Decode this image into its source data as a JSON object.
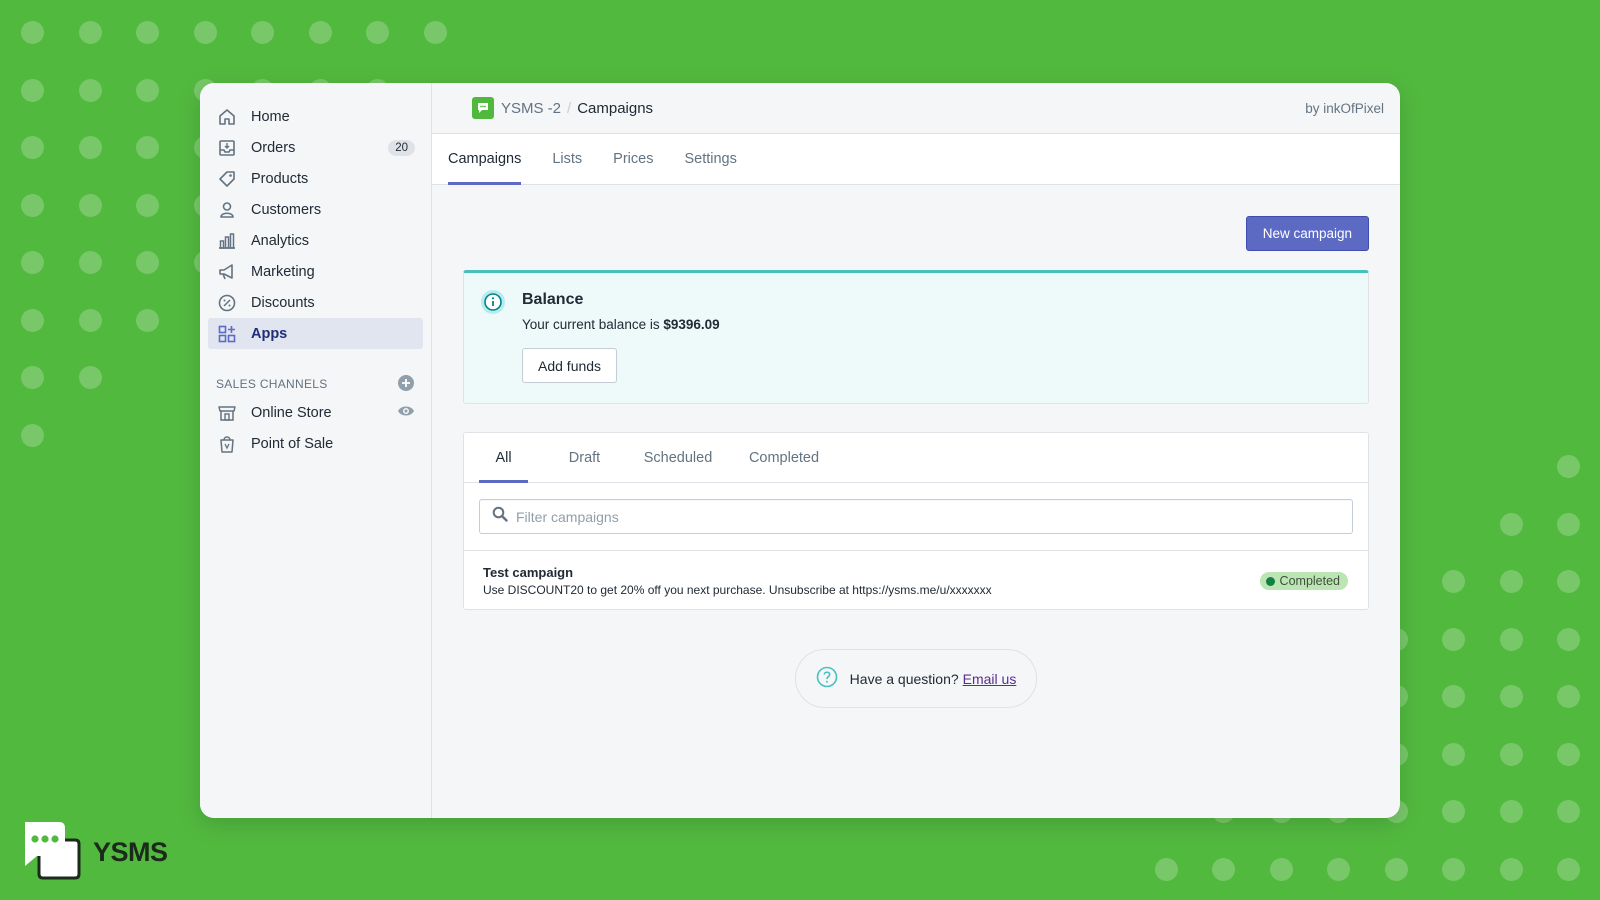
{
  "colors": {
    "background": "#52b93f",
    "primary": "#5c6ac4",
    "banner_accent": "#47c1bf",
    "status_success": "#108043",
    "link": "#5c2d91"
  },
  "sidebar": {
    "items": [
      {
        "label": "Home",
        "icon": "home-icon"
      },
      {
        "label": "Orders",
        "icon": "orders-icon",
        "badge": "20"
      },
      {
        "label": "Products",
        "icon": "tag-icon"
      },
      {
        "label": "Customers",
        "icon": "person-icon"
      },
      {
        "label": "Analytics",
        "icon": "bar-chart-icon"
      },
      {
        "label": "Marketing",
        "icon": "megaphone-icon"
      },
      {
        "label": "Discounts",
        "icon": "discount-icon"
      },
      {
        "label": "Apps",
        "icon": "apps-icon",
        "active": true
      }
    ],
    "sales_channels_heading": "SALES CHANNELS",
    "channels": [
      {
        "label": "Online Store",
        "icon": "store-icon"
      },
      {
        "label": "Point of Sale",
        "icon": "bag-icon"
      }
    ]
  },
  "topbar": {
    "app_name": "YSMS -2",
    "separator": "/",
    "page": "Campaigns",
    "byline": "by inkOfPixel"
  },
  "tabs": [
    "Campaigns",
    "Lists",
    "Prices",
    "Settings"
  ],
  "actions": {
    "new_campaign": "New campaign"
  },
  "balance": {
    "title": "Balance",
    "text": "Your current balance is",
    "amount": "$9396.09",
    "add_funds": "Add funds"
  },
  "campaign_tabs": [
    "All",
    "Draft",
    "Scheduled",
    "Completed"
  ],
  "filter": {
    "placeholder": "Filter campaigns"
  },
  "campaigns": [
    {
      "title": "Test campaign",
      "message": "Use DISCOUNT20 to get 20% off you next purchase. Unsubscribe at https://ysms.me/u/xxxxxxx",
      "status": "Completed"
    }
  ],
  "help": {
    "question": "Have a question?",
    "link": "Email us"
  },
  "brand": {
    "name": "YSMS"
  }
}
